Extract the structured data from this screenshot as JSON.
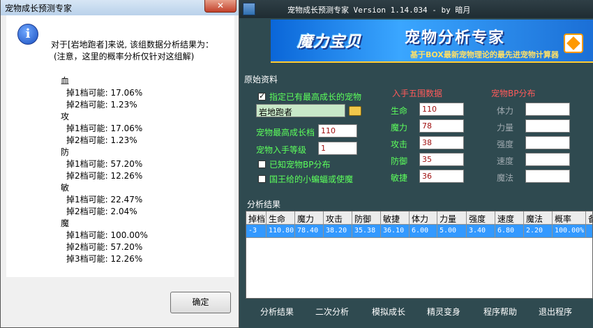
{
  "app": {
    "title": "宠物成长预测专家 Version 1.14.034 - by 暗月",
    "banner": {
      "logo": "魔力宝贝",
      "title": "宠物分析专家",
      "subtitle": "基于BOX最新宠物理论的最先进宠物计算器"
    },
    "origin": {
      "section_title": "原始资料",
      "specify_checkbox_label": "指定已有最高成长的宠物",
      "specify_checked": true,
      "pet_name": "岩地跑者",
      "max_growth_label": "宠物最高成长档",
      "max_growth_value": "110",
      "entry_level_label": "宠物入手等级",
      "entry_level_value": "1",
      "known_bp_label": "已知宠物BP分布",
      "king_bat_label": "国王给的小蝙蝠或使魔",
      "five_stats_title": "入手五围数据",
      "stats": [
        {
          "label": "生命",
          "value": "110"
        },
        {
          "label": "魔力",
          "value": "78"
        },
        {
          "label": "攻击",
          "value": "38"
        },
        {
          "label": "防御",
          "value": "35"
        },
        {
          "label": "敏捷",
          "value": "36"
        }
      ],
      "bp_title": "宠物BP分布",
      "bp_stats": [
        "体力",
        "力量",
        "强度",
        "速度",
        "魔法"
      ]
    },
    "results": {
      "title": "分析结果",
      "columns": [
        "掉档",
        "生命",
        "魔力",
        "攻击",
        "防御",
        "敏捷",
        "体力",
        "力量",
        "强度",
        "速度",
        "魔法",
        "概率",
        "备"
      ],
      "rows": [
        [
          "-3",
          "110.80",
          "78.40",
          "38.20",
          "35.38",
          "36.10",
          "6.00",
          "5.00",
          "3.40",
          "6.80",
          "2.20",
          "100.00%",
          ""
        ]
      ]
    },
    "bottom_buttons": [
      "分析结果",
      "二次分析",
      "模拟成长",
      "精灵变身",
      "程序帮助",
      "退出程序"
    ]
  },
  "dialog": {
    "title": "宠物成长预测专家",
    "close_label": "✕",
    "icon": "info-icon",
    "intro": "对于[岩地跑者]来说, 该组数据分析结果为：",
    "note": "(注意，这里的概率分析仅针对这组解)",
    "lines": [
      "血",
      "掉1档可能: 17.06%",
      "掉2档可能: 1.23%",
      "攻",
      "掉1档可能: 17.06%",
      "掉2档可能: 1.23%",
      "防",
      "掉1档可能: 57.20%",
      "掉2档可能: 12.26%",
      "敏",
      "掉1档可能: 22.47%",
      "掉2档可能: 2.04%",
      "魔",
      "掉1档可能: 100.00%",
      "掉2档可能: 57.20%",
      "掉3档可能: 12.26%"
    ],
    "ok_label": "确定"
  }
}
